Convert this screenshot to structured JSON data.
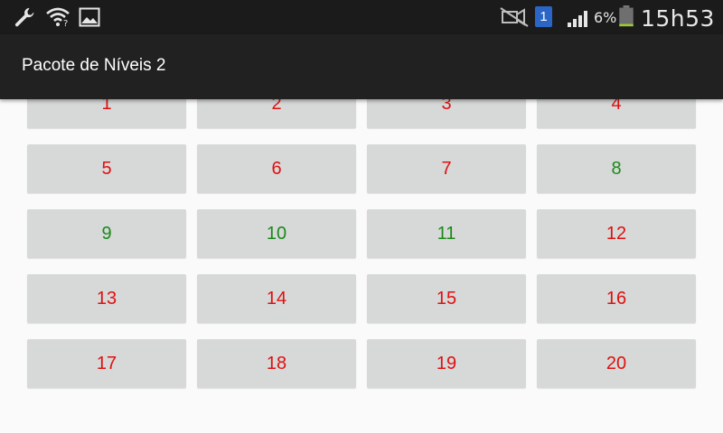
{
  "status_bar": {
    "time": "15h53",
    "battery_percent": "6%",
    "sim_slot": "1",
    "icons": [
      "wrench-icon",
      "wifi-icon",
      "image-icon",
      "mute-icon",
      "sim-icon",
      "signal-icon",
      "battery-icon"
    ]
  },
  "action_bar": {
    "title": "Pacote de Níveis 2"
  },
  "colors": {
    "locked": "#e01010",
    "completed": "#1a8a1a",
    "button_bg": "#d7d8d8",
    "action_bar_bg": "#212121"
  },
  "levels": [
    {
      "label": "1",
      "state": "locked"
    },
    {
      "label": "2",
      "state": "locked"
    },
    {
      "label": "3",
      "state": "locked"
    },
    {
      "label": "4",
      "state": "locked"
    },
    {
      "label": "5",
      "state": "locked"
    },
    {
      "label": "6",
      "state": "locked"
    },
    {
      "label": "7",
      "state": "locked"
    },
    {
      "label": "8",
      "state": "done"
    },
    {
      "label": "9",
      "state": "done"
    },
    {
      "label": "10",
      "state": "done"
    },
    {
      "label": "11",
      "state": "done"
    },
    {
      "label": "12",
      "state": "locked"
    },
    {
      "label": "13",
      "state": "locked"
    },
    {
      "label": "14",
      "state": "locked"
    },
    {
      "label": "15",
      "state": "locked"
    },
    {
      "label": "16",
      "state": "locked"
    },
    {
      "label": "17",
      "state": "locked"
    },
    {
      "label": "18",
      "state": "locked"
    },
    {
      "label": "19",
      "state": "locked"
    },
    {
      "label": "20",
      "state": "locked"
    }
  ]
}
